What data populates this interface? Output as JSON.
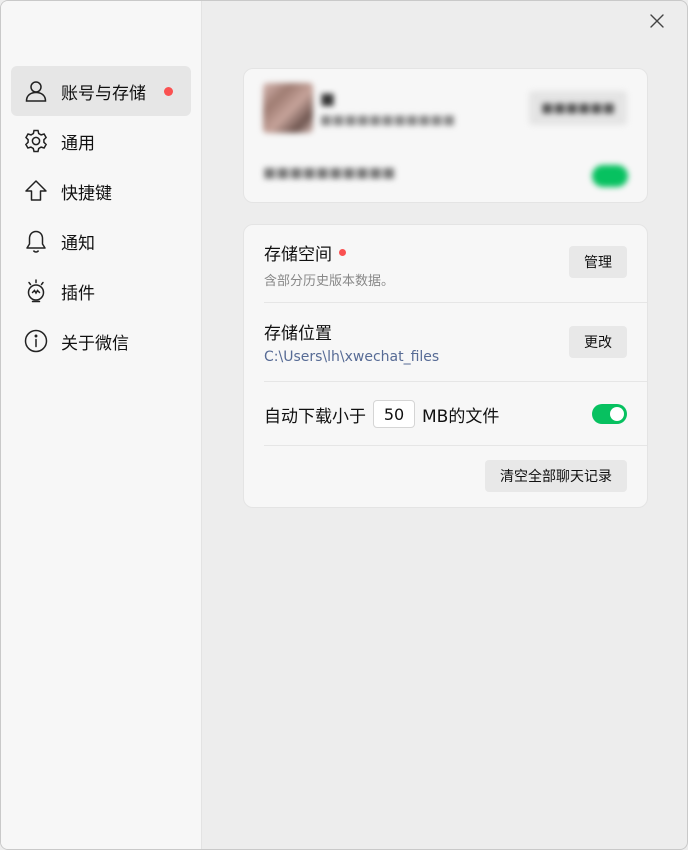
{
  "sidebar": {
    "items": [
      {
        "label": "账号与存储",
        "icon": "person-icon",
        "active": true,
        "badge": true
      },
      {
        "label": "通用",
        "icon": "gear-icon"
      },
      {
        "label": "快捷键",
        "icon": "arrow-up-icon"
      },
      {
        "label": "通知",
        "icon": "bell-icon"
      },
      {
        "label": "插件",
        "icon": "plugin-bulb-icon"
      },
      {
        "label": "关于微信",
        "icon": "info-icon"
      }
    ]
  },
  "account": {
    "name": "■",
    "id": "■■■■■■■■■■■",
    "button": "■■■■■■",
    "status": "■■■■■■■■■■"
  },
  "storage": {
    "space": {
      "title": "存储空间",
      "subtitle": "含部分历史版本数据。",
      "button": "管理"
    },
    "location": {
      "title": "存储位置",
      "path": "C:\\Users\\lh\\xwechat_files",
      "button": "更改"
    },
    "auto_download": {
      "prefix": "自动下载小于",
      "value": "50",
      "suffix": "MB的文件",
      "enabled": true
    },
    "clear_button": "清空全部聊天记录"
  },
  "colors": {
    "accent": "#07c160",
    "badge": "#fa5151",
    "link": "#576b95"
  }
}
